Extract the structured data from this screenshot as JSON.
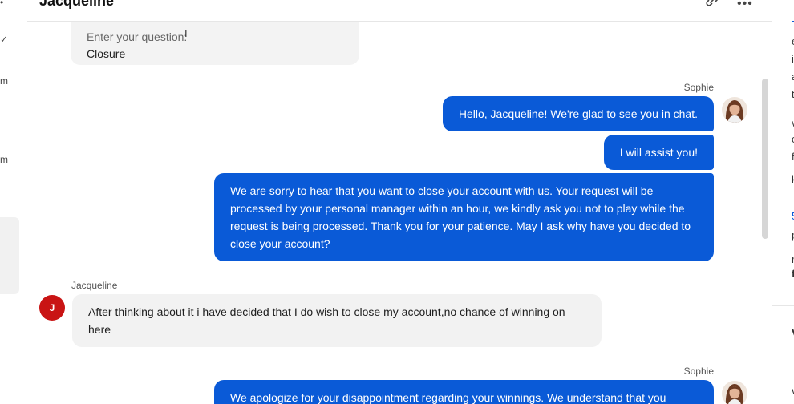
{
  "header": {
    "title": "Jacqueline",
    "link_icon": "link-icon",
    "more_icon": "more-options-icon"
  },
  "left_rail": {
    "glyphs": [
      "•",
      "✓",
      "m",
      "m"
    ]
  },
  "question_card": {
    "label": "Enter your question:",
    "value": "Closure"
  },
  "messages": {
    "m1_sender": "Sophie",
    "m1_text": "Hello, Jacqueline! We're glad to see you in chat.",
    "m2_text": "I will assist you!",
    "m3_text": "We are sorry to hear that you want to close your account with us. Your request will be processed by your personal manager within an hour, we kindly ask you not to play while the request is being processed. Thank you for your patience. May I ask why have you decided to close your account?",
    "m4_sender": "Jacqueline",
    "m4_initial": "J",
    "m4_text": "After thinking about it i have decided that I do wish to close my account,no chance of winning on here",
    "m5_sender": "Sophie",
    "m5_text": "We apologize for your disappointment regarding your winnings. We understand that you"
  },
  "right_panel": {
    "fragments": [
      "e",
      "i",
      "a",
      "t",
      "v",
      "c",
      "f",
      "k",
      "5",
      "p",
      "r",
      "f",
      "V",
      "v"
    ]
  },
  "colors": {
    "agent_bubble": "#0a5ad7",
    "customer_bubble": "#f2f2f2",
    "customer_avatar": "#c91414"
  }
}
